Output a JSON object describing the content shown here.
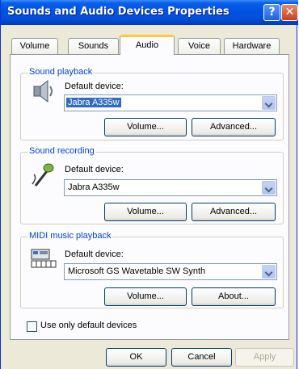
{
  "window": {
    "title": "Sounds and Audio Devices Properties",
    "help_glyph": "?",
    "close_glyph": "✕"
  },
  "tabs": [
    "Volume",
    "Sounds",
    "Audio",
    "Voice",
    "Hardware"
  ],
  "active_tab": "Audio",
  "sound_playback": {
    "group_label": "Sound playback",
    "default_device_label": "Default device:",
    "device": "Jabra A335w",
    "volume_button": "Volume...",
    "advanced_button": "Advanced...",
    "icon": "speaker-icon"
  },
  "sound_recording": {
    "group_label": "Sound recording",
    "default_device_label": "Default device:",
    "device": "Jabra A335w",
    "volume_button": "Volume...",
    "advanced_button": "Advanced...",
    "icon": "microphone-icon"
  },
  "midi_playback": {
    "group_label": "MIDI music playback",
    "default_device_label": "Default device:",
    "device": "Microsoft GS Wavetable SW Synth",
    "volume_button": "Volume...",
    "about_button": "About...",
    "icon": "keyboard-synth-icon"
  },
  "use_default_devices": {
    "label": "Use only default devices",
    "checked": false
  },
  "footer": {
    "ok": "OK",
    "cancel": "Cancel",
    "apply": "Apply"
  },
  "colors": {
    "title_bar": "#0054e3",
    "group_label": "#0046d5",
    "active_tab_accent": "#ffc83c"
  }
}
